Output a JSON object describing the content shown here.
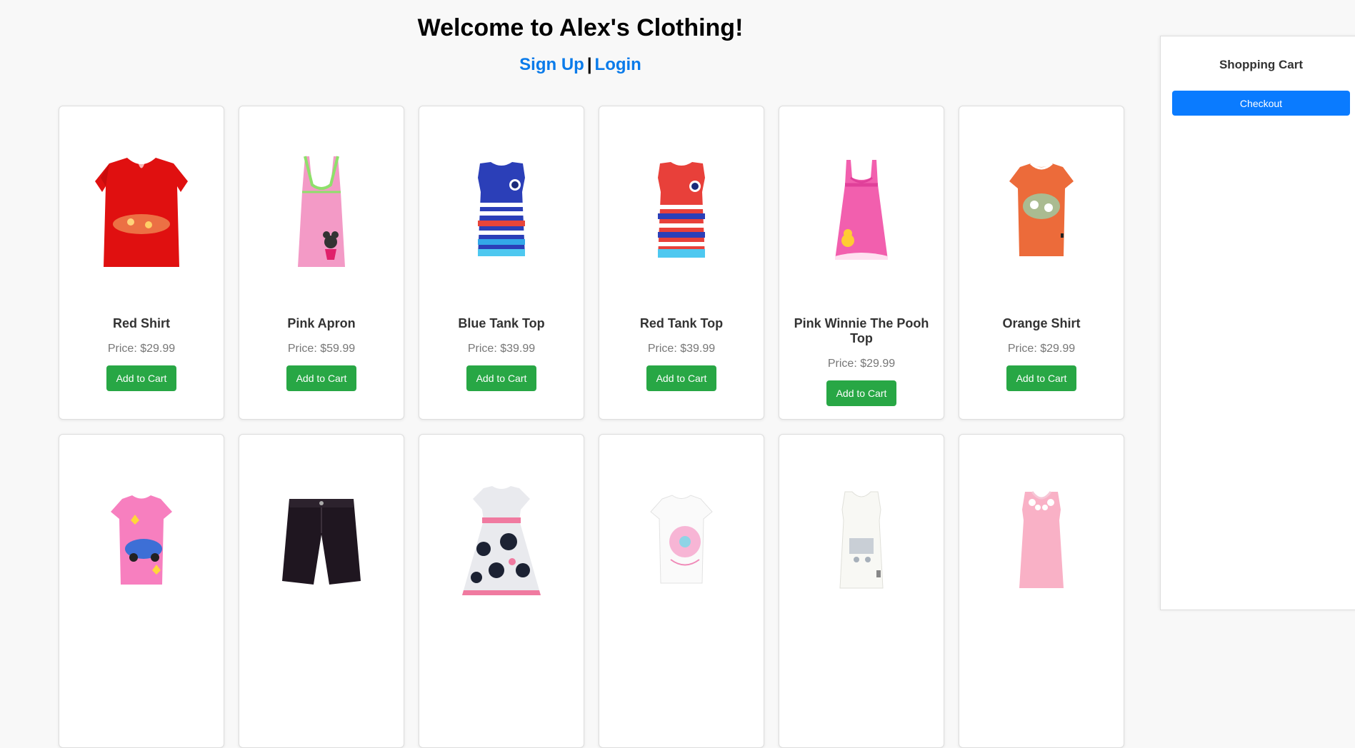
{
  "header": {
    "title": "Welcome to Alex's Clothing!",
    "signup_label": "Sign Up",
    "separator": "|",
    "login_label": "Login"
  },
  "products": [
    {
      "name": "Red Shirt",
      "price": "Price: $29.99",
      "button": "Add to Cart",
      "icon": "red-shirt-image"
    },
    {
      "name": "Pink Apron",
      "price": "Price: $59.99",
      "button": "Add to Cart",
      "icon": "pink-apron-image"
    },
    {
      "name": "Blue Tank Top",
      "price": "Price: $39.99",
      "button": "Add to Cart",
      "icon": "blue-tank-top-image"
    },
    {
      "name": "Red Tank Top",
      "price": "Price: $39.99",
      "button": "Add to Cart",
      "icon": "red-tank-top-image"
    },
    {
      "name": "Pink Winnie The Pooh Top",
      "price": "Price: $29.99",
      "button": "Add to Cart",
      "icon": "pink-winnie-top-image"
    },
    {
      "name": "Orange Shirt",
      "price": "Price: $29.99",
      "button": "Add to Cart",
      "icon": "orange-shirt-image"
    },
    {
      "icon": "pink-tshirt-image"
    },
    {
      "icon": "black-shorts-image"
    },
    {
      "icon": "floral-dress-image"
    },
    {
      "icon": "white-tshirt-image"
    },
    {
      "icon": "white-tank-top-image"
    },
    {
      "icon": "pink-tank-top-image"
    }
  ],
  "cart": {
    "title": "Shopping Cart",
    "checkout_label": "Checkout"
  },
  "colors": {
    "link": "#0a7bea",
    "add_to_cart": "#28a745",
    "checkout": "#0a7bff"
  }
}
